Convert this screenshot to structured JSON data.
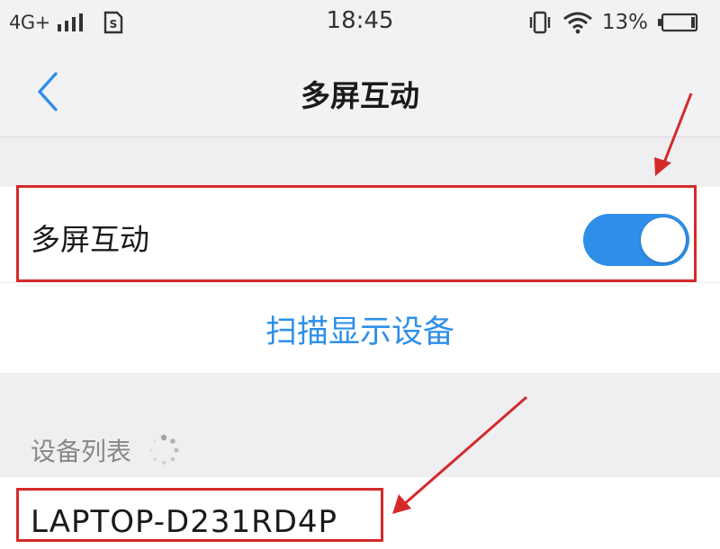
{
  "status_bar": {
    "network": "4G+",
    "time": "18:45",
    "battery_percent": "13%",
    "icons": [
      "signal-bars-icon",
      "sim-card-icon",
      "vibrate-icon",
      "wifi-icon",
      "battery-icon"
    ]
  },
  "nav": {
    "title": "多屏互动",
    "back_icon": "chevron-left-icon"
  },
  "settings": {
    "toggle_label": "多屏互动",
    "toggle_state": "on",
    "scan_label": "扫描显示设备"
  },
  "device_list": {
    "header": "设备列表",
    "loading_icon": "loading-spinner-icon",
    "devices": [
      {
        "name": "LAPTOP-D231RD4P"
      }
    ]
  },
  "annotations": {
    "highlight_color": "#d42a2a",
    "arrows": 2,
    "boxes": 2
  },
  "colors": {
    "accent": "#2f8fe8",
    "background": "#efeff1",
    "surface": "#ffffff",
    "secondary_text": "#888888"
  }
}
